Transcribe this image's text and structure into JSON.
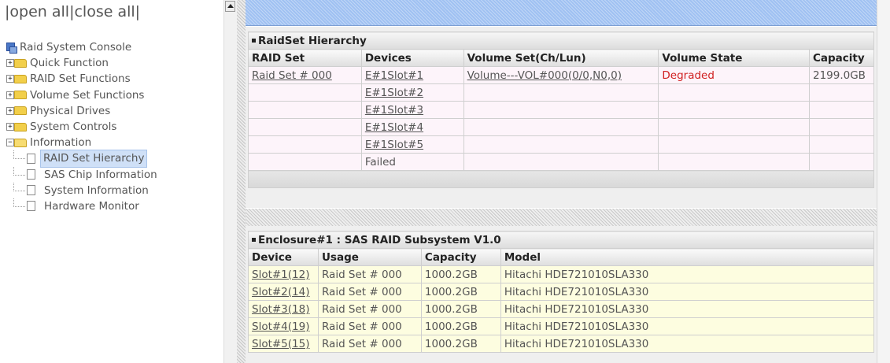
{
  "left": {
    "open_all": "open all",
    "close_all": "close all",
    "root": "Raid System Console",
    "folders": [
      {
        "label": "Quick Function",
        "expanded": false
      },
      {
        "label": "RAID Set Functions",
        "expanded": false
      },
      {
        "label": "Volume Set Functions",
        "expanded": false
      },
      {
        "label": "Physical Drives",
        "expanded": false
      },
      {
        "label": "System Controls",
        "expanded": false
      },
      {
        "label": "Information",
        "expanded": true
      }
    ],
    "info_items": [
      {
        "label": "RAID Set Hierarchy",
        "selected": true
      },
      {
        "label": "SAS Chip Information",
        "selected": false
      },
      {
        "label": "System Information",
        "selected": false
      },
      {
        "label": "Hardware Monitor",
        "selected": false
      }
    ]
  },
  "raidset": {
    "title": "RaidSet Hierarchy",
    "headers": [
      "RAID Set",
      "Devices",
      "Volume Set(Ch/Lun)",
      "Volume State",
      "Capacity"
    ],
    "rows": [
      {
        "raid_set": "Raid Set # 000",
        "device": "E#1Slot#1",
        "volume": "Volume---VOL#000(0/0,N0,0)",
        "state": "Degraded",
        "capacity": "2199.0GB"
      },
      {
        "raid_set": "",
        "device": "E#1Slot#2",
        "volume": "",
        "state": "",
        "capacity": ""
      },
      {
        "raid_set": "",
        "device": "E#1Slot#3",
        "volume": "",
        "state": "",
        "capacity": ""
      },
      {
        "raid_set": "",
        "device": "E#1Slot#4",
        "volume": "",
        "state": "",
        "capacity": ""
      },
      {
        "raid_set": "",
        "device": "E#1Slot#5",
        "volume": "",
        "state": "",
        "capacity": ""
      },
      {
        "raid_set": "",
        "device": "Failed",
        "volume": "",
        "state": "",
        "capacity": ""
      }
    ]
  },
  "enclosure": {
    "title": "Enclosure#1 : SAS RAID Subsystem V1.0",
    "headers": [
      "Device",
      "Usage",
      "Capacity",
      "Model"
    ],
    "rows": [
      {
        "device": "Slot#1(12)",
        "usage": "Raid Set # 000",
        "capacity": "1000.2GB",
        "model": "Hitachi HDE721010SLA330"
      },
      {
        "device": "Slot#2(14)",
        "usage": "Raid Set # 000",
        "capacity": "1000.2GB",
        "model": "Hitachi HDE721010SLA330"
      },
      {
        "device": "Slot#3(18)",
        "usage": "Raid Set # 000",
        "capacity": "1000.2GB",
        "model": "Hitachi HDE721010SLA330"
      },
      {
        "device": "Slot#4(19)",
        "usage": "Raid Set # 000",
        "capacity": "1000.2GB",
        "model": "Hitachi HDE721010SLA330"
      },
      {
        "device": "Slot#5(15)",
        "usage": "Raid Set # 000",
        "capacity": "1000.2GB",
        "model": "Hitachi HDE721010SLA330"
      }
    ]
  },
  "colors": {
    "degraded": "#d02020",
    "header_bar": "#9fc1f2"
  }
}
